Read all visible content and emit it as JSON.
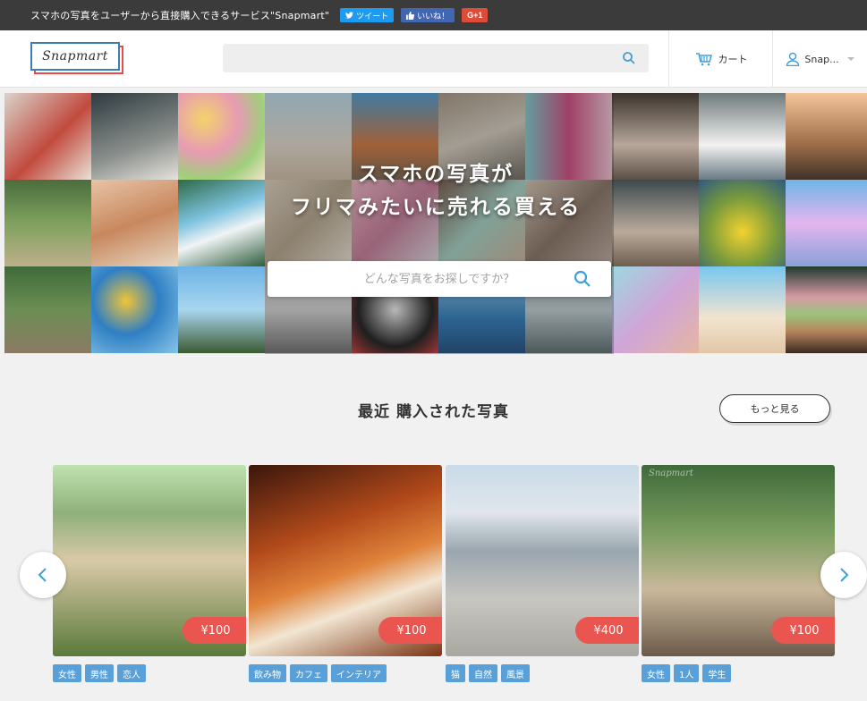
{
  "topbar": {
    "text": "スマホの写真をユーザーから直接購入できるサービス\"Snapmart\"",
    "tweet_label": "ツイート",
    "like_label": "いいね！",
    "gplus_label": "G+1"
  },
  "header": {
    "logo_text": "Snapmart",
    "search_placeholder": "",
    "cart_label": "カート",
    "user_label": "Snap..."
  },
  "hero": {
    "line1": "スマホの写真が",
    "line2": "フリマみたいに売れる買える",
    "search_placeholder": "どんな写真をお探しですか？"
  },
  "section": {
    "title": "最近 購入された写真",
    "more_label": "もっと見る"
  },
  "cards": [
    {
      "price": "¥100",
      "tags": [
        "女性",
        "男性",
        "恋人"
      ],
      "watermark": ""
    },
    {
      "price": "¥100",
      "tags": [
        "飲み物",
        "カフェ",
        "インテリア"
      ],
      "watermark": ""
    },
    {
      "price": "¥400",
      "tags": [
        "猫",
        "自然",
        "風景"
      ],
      "watermark": ""
    },
    {
      "price": "¥100",
      "tags": [
        "女性",
        "1人",
        "学生"
      ],
      "watermark": "Snapmart"
    }
  ],
  "colors": {
    "topbar_bg": "#3b3b3b",
    "accent_blue": "#5aa0d8",
    "price_red": "#ea5550",
    "logo_red": "#e94b4b",
    "logo_blue": "#3f7db8"
  }
}
